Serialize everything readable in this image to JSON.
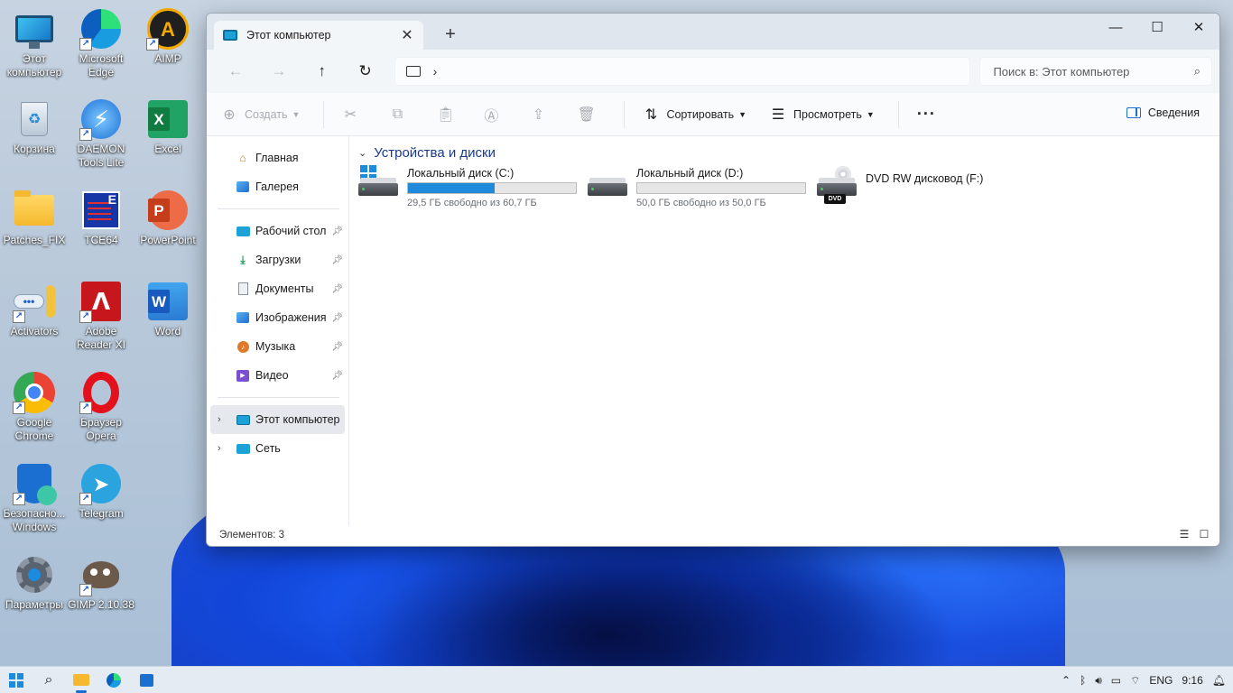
{
  "desktop": {
    "icons": [
      {
        "label": "Этот компьютер",
        "icon": "monitor-icon"
      },
      {
        "label": "Microsoft Edge",
        "icon": "edge-icon"
      },
      {
        "label": "AIMP",
        "icon": "aimp-icon"
      },
      {
        "label": "Корзина",
        "icon": "recycle-bin-icon"
      },
      {
        "label": "DAEMON Tools Lite",
        "icon": "daemon-tools-icon"
      },
      {
        "label": "Excel",
        "icon": "excel-icon"
      },
      {
        "label": "Patches_FIX",
        "icon": "folder-icon"
      },
      {
        "label": "TCE64",
        "icon": "tce64-icon"
      },
      {
        "label": "PowerPoint",
        "icon": "powerpoint-icon"
      },
      {
        "label": "Activators",
        "icon": "key-icon"
      },
      {
        "label": "Adobe Reader XI",
        "icon": "adobe-reader-icon"
      },
      {
        "label": "Word",
        "icon": "word-icon"
      },
      {
        "label": "Google Chrome",
        "icon": "chrome-icon"
      },
      {
        "label": "Браузер Opera",
        "icon": "opera-icon"
      },
      {
        "label": "Безопасно... Windows",
        "icon": "shield-icon"
      },
      {
        "label": "Telegram",
        "icon": "telegram-icon"
      },
      {
        "label": "Параметры",
        "icon": "settings-gear-icon"
      },
      {
        "label": "GIMP 2.10.38",
        "icon": "gimp-icon"
      }
    ]
  },
  "explorer": {
    "tab_title": "Этот компьютер",
    "tab_close": "✕",
    "new_tab": "+",
    "window_controls": {
      "minimize": "—",
      "maximize": "☐",
      "close": "✕"
    },
    "nav": {
      "back": "←",
      "forward": "→",
      "up": "↑",
      "refresh": "↻"
    },
    "address_chevron": "›",
    "search_placeholder": "Поиск в: Этот компьютер",
    "toolbar": {
      "create": "Создать",
      "sort": "Сортировать",
      "view": "Просмотреть",
      "more": "···",
      "details": "Сведения"
    },
    "sidebar": {
      "quick": [
        {
          "label": "Главная",
          "icon": "home-icon"
        },
        {
          "label": "Галерея",
          "icon": "gallery-icon"
        }
      ],
      "pinned": [
        {
          "label": "Рабочий стол",
          "icon": "desktop-folder-icon"
        },
        {
          "label": "Загрузки",
          "icon": "downloads-icon"
        },
        {
          "label": "Документы",
          "icon": "documents-icon"
        },
        {
          "label": "Изображения",
          "icon": "pictures-icon"
        },
        {
          "label": "Музыка",
          "icon": "music-icon"
        },
        {
          "label": "Видео",
          "icon": "video-icon"
        }
      ],
      "tree": [
        {
          "label": "Этот компьютер",
          "icon": "this-pc-icon"
        },
        {
          "label": "Сеть",
          "icon": "network-icon"
        }
      ]
    },
    "group_title": "Устройства и диски",
    "drives": [
      {
        "name": "Локальный диск (C:)",
        "free_text": "29,5 ГБ свободно из 60,7 ГБ",
        "used_fraction": 0.514
      },
      {
        "name": "Локальный диск (D:)",
        "free_text": "50,0 ГБ свободно из 50,0 ГБ",
        "used_fraction": 0.0
      },
      {
        "name": "DVD RW дисковод (F:)",
        "badge": "DVD"
      }
    ],
    "status": "Элементов: 3"
  },
  "taskbar": {
    "tray": {
      "lang": "ENG",
      "time": "9:16"
    }
  },
  "colors": {
    "accent": "#1b6fd0",
    "drive_fill": "#1f8ad9",
    "group_title": "#1a3a8f"
  }
}
